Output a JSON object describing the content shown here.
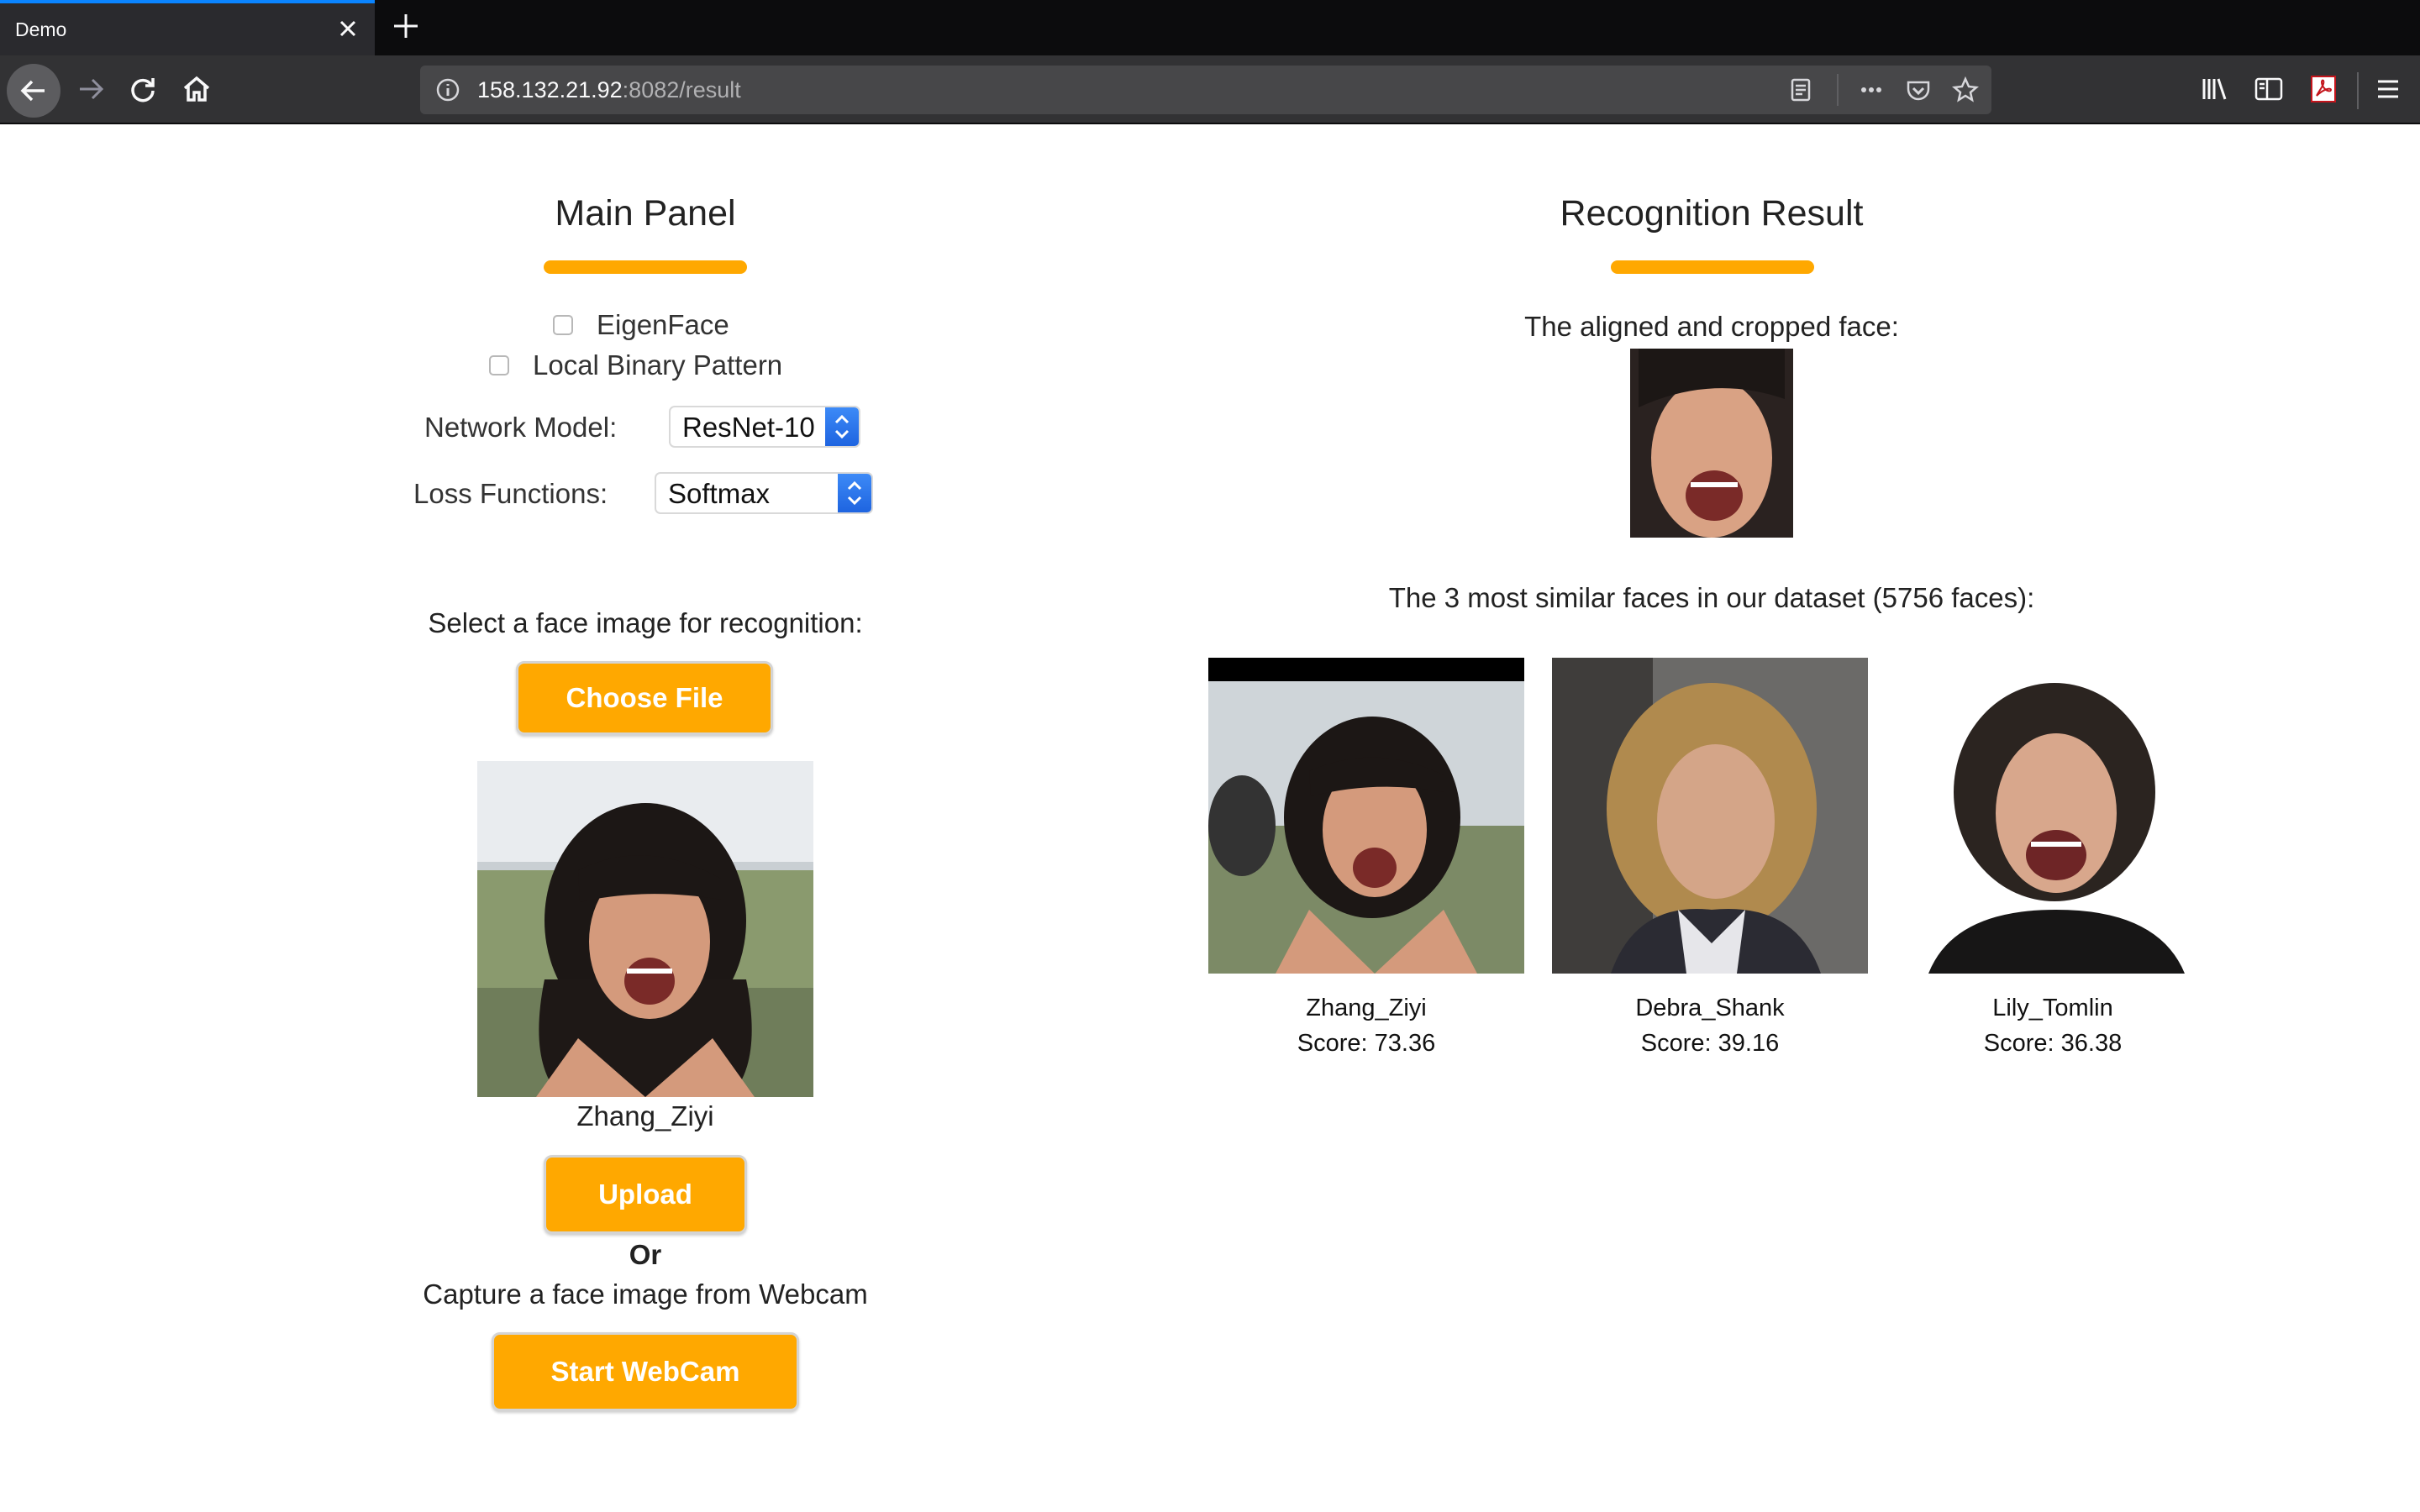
{
  "browser": {
    "tab_title": "Demo",
    "url_host": "158.132.21.92",
    "url_rest": ":8082/result"
  },
  "main_panel": {
    "title": "Main Panel",
    "methods": [
      {
        "label": "EigenFace",
        "checked": false
      },
      {
        "label": "Local Binary Pattern",
        "checked": false
      }
    ],
    "network_model": {
      "label": "Network Model:",
      "value": "ResNet-10"
    },
    "loss_functions": {
      "label": "Loss Functions:",
      "value": "Softmax"
    },
    "select_prompt": "Select a face image for recognition:",
    "choose_file_label": "Choose File",
    "uploaded_name": "Zhang_Ziyi",
    "upload_label": "Upload",
    "or_label": "Or",
    "webcam_prompt": "Capture a face image from Webcam",
    "start_webcam_label": "Start WebCam"
  },
  "result": {
    "title": "Recognition Result",
    "aligned_caption": "The aligned and cropped face:",
    "similar_caption": "The 3 most similar faces in our dataset (5756 faces):",
    "matches": [
      {
        "name": "Zhang_Ziyi",
        "score": "Score: 73.36"
      },
      {
        "name": "Debra_Shank",
        "score": "Score: 39.16"
      },
      {
        "name": "Lily_Tomlin",
        "score": "Score: 36.38"
      }
    ]
  },
  "colors": {
    "accent": "#ffa800",
    "select_arrow": "#2f7cf2",
    "chrome_dark": "#0c0c0d"
  }
}
